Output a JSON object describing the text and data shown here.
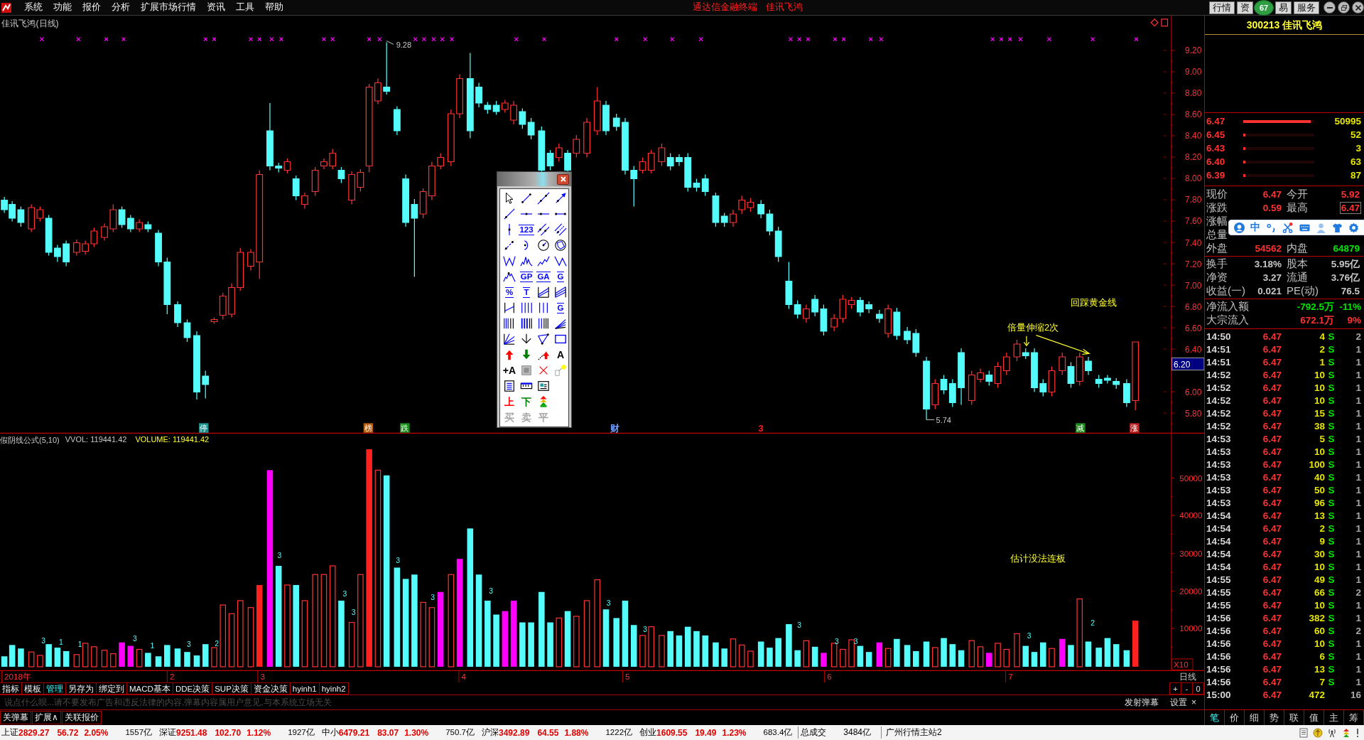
{
  "menu_bar": {
    "items": [
      "系统",
      "功能",
      "报价",
      "分析",
      "扩展市场行情",
      "资讯",
      "工具",
      "帮助"
    ],
    "title": "通达信金融终端",
    "subtitle": "佳讯飞鸿",
    "buttons": [
      "行情",
      "资",
      "易",
      "服务"
    ],
    "badge": "67"
  },
  "price_chart": {
    "title": "佳讯飞鸿(日线)",
    "high_label": "9.28",
    "low_label": "5.74",
    "annotations": [
      "回踩黄金线",
      "倍量伸缩2次"
    ],
    "event_tags": [
      {
        "kind": "tag",
        "text": "停",
        "color": "#1f8f8f"
      },
      {
        "kind": "tag",
        "text": "榜",
        "color": "#b05a10"
      },
      {
        "kind": "tag",
        "text": "跌",
        "color": "#1a8a1a"
      },
      {
        "kind": "text",
        "text": "财",
        "color": "#6f9fff"
      },
      {
        "kind": "text",
        "text": "3",
        "color": "#ff2020"
      },
      {
        "kind": "tag",
        "text": "减",
        "color": "#1a8a1a"
      },
      {
        "kind": "tag",
        "text": "涨",
        "color": "#c02020"
      }
    ],
    "axis_labels": [
      "9.20",
      "9.00",
      "8.80",
      "8.60",
      "8.40",
      "8.20",
      "8.00",
      "7.80",
      "7.60",
      "7.40",
      "7.20",
      "7.00",
      "6.80",
      "6.60",
      "6.40",
      "6.00",
      "5.80"
    ],
    "cursor_price": "6.20"
  },
  "volume_chart": {
    "indicator": "假阴线公式(5,10)",
    "vvol": "VVOL: 119441.42",
    "volume": "VOLUME: 119441.42",
    "annotation": "估计没法连板",
    "bar_marks": [
      "3",
      "1",
      "1",
      "3",
      "1",
      "3",
      "2",
      "3",
      "3",
      "3",
      "3",
      "3",
      "3",
      "3",
      "3",
      "3",
      "3",
      "3",
      "3",
      "2"
    ],
    "axis_labels": [
      "50000",
      "40000",
      "30000",
      "20000",
      "10000"
    ],
    "scale": "X10"
  },
  "date_axis": [
    "2018年",
    "2",
    "3",
    "4",
    "5",
    "6",
    "7"
  ],
  "period": "日线",
  "zoom_buttons": [
    "+",
    "-",
    "0"
  ],
  "formula_tabs": [
    {
      "label": "指标",
      "selected": false
    },
    {
      "label": "模板",
      "selected": false
    },
    {
      "label": "管理",
      "selected": true
    },
    {
      "label": "另存为",
      "selected": false
    },
    {
      "label": "绑定到",
      "selected": false
    },
    {
      "label": "MACD基本",
      "selected": false
    },
    {
      "label": "DDE决策",
      "selected": false
    },
    {
      "label": "SUP决策",
      "selected": false
    },
    {
      "label": "资金决策",
      "selected": false
    },
    {
      "label": "hyinh1",
      "selected": false
    },
    {
      "label": "hyinh2",
      "selected": false
    }
  ],
  "danmaku": {
    "placeholder": "说点什么呗...请不要发布广告和违反法律的内容,弹幕内容属用户意见,与本系统立场无关",
    "send": "发射弹幕",
    "settings": "设置",
    "close": "×"
  },
  "bottom_buttons": [
    "关弹幕",
    "扩展∧",
    "关联报价"
  ],
  "drawing_toolbar": {
    "rows": [
      {
        "tools": [
          {
            "kind": "pointer",
            "disabled": false
          },
          {
            "kind": "segment",
            "disabled": false
          },
          {
            "kind": "line",
            "disabled": false
          },
          {
            "kind": "arrowline",
            "disabled": false
          }
        ]
      },
      {
        "tools": [
          {
            "kind": "ray",
            "disabled": false
          },
          {
            "kind": "hray",
            "disabled": false
          },
          {
            "kind": "hline",
            "disabled": false
          },
          {
            "kind": "hsegment",
            "disabled": false
          }
        ]
      },
      {
        "tools": [
          {
            "kind": "vline",
            "disabled": false
          },
          {
            "kind": "ruled",
            "text": "123",
            "color": "#0000ff",
            "disabled": false
          },
          {
            "kind": "parallel",
            "disabled": false
          },
          {
            "kind": "channel",
            "disabled": false
          }
        ]
      },
      {
        "tools": [
          {
            "kind": "dashed",
            "disabled": false
          },
          {
            "kind": "arc",
            "disabled": false
          },
          {
            "kind": "circle",
            "disabled": false
          },
          {
            "kind": "cycle",
            "disabled": false
          }
        ]
      },
      {
        "tools": [
          {
            "kind": "wave",
            "disabled": false
          },
          {
            "kind": "peaks",
            "disabled": false
          },
          {
            "kind": "zigzag",
            "disabled": false
          },
          {
            "kind": "vshape",
            "disabled": false
          }
        ]
      },
      {
        "tools": [
          {
            "kind": "mountain",
            "disabled": false
          },
          {
            "kind": "ruled",
            "text": "GP",
            "color": "#0000ff",
            "disabled": false
          },
          {
            "kind": "ruled",
            "text": "GA",
            "color": "#0000ff",
            "disabled": false
          },
          {
            "kind": "ruled",
            "text": "G",
            "color": "#0000ff",
            "disabled": false
          }
        ]
      },
      {
        "tools": [
          {
            "kind": "ruled",
            "text": "%",
            "color": "#0000ff",
            "disabled": false
          },
          {
            "kind": "ruled",
            "text": "T",
            "color": "#0000ff",
            "disabled": false
          },
          {
            "kind": "fanbox",
            "disabled": false
          },
          {
            "kind": "fanbox2",
            "disabled": false
          }
        ]
      },
      {
        "tools": [
          {
            "kind": "timebar",
            "disabled": false
          },
          {
            "kind": "vlines4",
            "disabled": false
          },
          {
            "kind": "vlines3",
            "disabled": false
          },
          {
            "kind": "ruled",
            "text": "G",
            "color": "#0000ff",
            "disabled": false
          }
        ]
      },
      {
        "tools": [
          {
            "kind": "vlines6",
            "disabled": false
          },
          {
            "kind": "vlinesbold",
            "disabled": false
          },
          {
            "kind": "vlines5",
            "disabled": false
          },
          {
            "kind": "fan",
            "disabled": false
          }
        ]
      },
      {
        "tools": [
          {
            "kind": "gannfan",
            "disabled": false
          },
          {
            "kind": "vdown",
            "disabled": false
          },
          {
            "kind": "triangle",
            "disabled": false
          },
          {
            "kind": "rect",
            "disabled": false
          }
        ]
      },
      {
        "tools": [
          {
            "kind": "uparrow",
            "disabled": false
          },
          {
            "kind": "downarrow",
            "disabled": false
          },
          {
            "kind": "linearrow",
            "disabled": false
          },
          {
            "kind": "text",
            "text": "A",
            "color": "#000000",
            "disabled": false
          }
        ]
      },
      {
        "tools": [
          {
            "kind": "text",
            "text": "+A",
            "color": "#000000",
            "disabled": false
          },
          {
            "kind": "square",
            "disabled": false
          },
          {
            "kind": "cross",
            "disabled": false
          },
          {
            "kind": "pin",
            "disabled": false
          }
        ]
      },
      {
        "tools": [
          {
            "kind": "list",
            "disabled": false
          },
          {
            "kind": "ruler",
            "disabled": false
          },
          {
            "kind": "image",
            "disabled": false
          }
        ]
      },
      {
        "tools": [
          {
            "kind": "text",
            "text": "上",
            "color": "#ff0000",
            "disabled": false
          },
          {
            "kind": "text",
            "text": "下",
            "color": "#008000",
            "disabled": false
          },
          {
            "kind": "stack",
            "disabled": false
          }
        ]
      },
      {
        "tools": [
          {
            "kind": "text",
            "text": "买",
            "disabled": true
          },
          {
            "kind": "text",
            "text": "卖",
            "disabled": true
          },
          {
            "kind": "text",
            "text": "平",
            "disabled": true
          }
        ]
      }
    ]
  },
  "quote_panel": {
    "title": "300213 佳讯飞鸿",
    "bids": [
      {
        "price": "6.47",
        "volume": "50995",
        "level": 0.95
      },
      {
        "price": "6.45",
        "volume": "52",
        "level": 0.03
      },
      {
        "price": "6.43",
        "volume": "3",
        "level": 0.03
      },
      {
        "price": "6.40",
        "volume": "63",
        "level": 0.03
      },
      {
        "price": "6.39",
        "volume": "87",
        "level": 0.03
      }
    ],
    "stats": [
      {
        "cells": [
          {
            "label": "现价",
            "value": "6.47",
            "color": "#ff3232",
            "boxed": false
          },
          {
            "label": "今开",
            "value": "5.92",
            "color": "#ff3232",
            "boxed": false
          }
        ]
      },
      {
        "cells": [
          {
            "label": "涨跌",
            "value": "0.59",
            "color": "#ff3232",
            "boxed": false
          },
          {
            "label": "最高",
            "value": "6.47",
            "color": "#ff3232",
            "boxed": true
          }
        ]
      },
      {
        "cells": [
          {
            "label": "涨幅"
          }
        ]
      },
      {
        "cells": [
          {
            "label": "总量"
          }
        ]
      },
      {
        "cells": [
          {
            "label": "外盘",
            "value": "54562",
            "color": "#ff3232",
            "boxed": false
          },
          {
            "label": "内盘",
            "value": "64879",
            "color": "#00e600",
            "boxed": false
          }
        ]
      }
    ],
    "fundamentals": [
      {
        "cells": [
          {
            "label": "换手",
            "value": "3.18%",
            "color": "#c8c8c8",
            "boxed": false
          },
          {
            "label": "股本",
            "value": "5.95亿",
            "color": "#c8c8c8",
            "boxed": false
          }
        ]
      },
      {
        "cells": [
          {
            "label": "净资",
            "value": "3.27",
            "color": "#c8c8c8",
            "boxed": false
          },
          {
            "label": "流通",
            "value": "3.76亿",
            "color": "#c8c8c8",
            "boxed": false
          }
        ]
      },
      {
        "cells": [
          {
            "label": "收益(一)",
            "value": "0.021",
            "color": "#c8c8c8",
            "boxed": false
          },
          {
            "label": "PE(动)",
            "value": "76.5",
            "color": "#c8c8c8",
            "boxed": false
          }
        ]
      }
    ],
    "flows": [
      {
        "label": "净流入额",
        "amount": "-792.5万",
        "percent": "-11%",
        "color": "#00e600"
      },
      {
        "label": "大宗流入",
        "amount": "672.1万",
        "percent": "9%",
        "color": "#ff3232"
      }
    ],
    "ticks": [
      {
        "time": "14:50",
        "price": "6.47",
        "volume": "4",
        "side": "S",
        "count": "2"
      },
      {
        "time": "14:51",
        "price": "6.47",
        "volume": "2",
        "side": "S",
        "count": "1"
      },
      {
        "time": "14:51",
        "price": "6.47",
        "volume": "1",
        "side": "S",
        "count": "1"
      },
      {
        "time": "14:52",
        "price": "6.47",
        "volume": "10",
        "side": "S",
        "count": "1"
      },
      {
        "time": "14:52",
        "price": "6.47",
        "volume": "10",
        "side": "S",
        "count": "1"
      },
      {
        "time": "14:52",
        "price": "6.47",
        "volume": "10",
        "side": "S",
        "count": "1"
      },
      {
        "time": "14:52",
        "price": "6.47",
        "volume": "15",
        "side": "S",
        "count": "1"
      },
      {
        "time": "14:52",
        "price": "6.47",
        "volume": "38",
        "side": "S",
        "count": "1"
      },
      {
        "time": "14:53",
        "price": "6.47",
        "volume": "5",
        "side": "S",
        "count": "1"
      },
      {
        "time": "14:53",
        "price": "6.47",
        "volume": "10",
        "side": "S",
        "count": "1"
      },
      {
        "time": "14:53",
        "price": "6.47",
        "volume": "100",
        "side": "S",
        "count": "1"
      },
      {
        "time": "14:53",
        "price": "6.47",
        "volume": "40",
        "side": "S",
        "count": "1"
      },
      {
        "time": "14:53",
        "price": "6.47",
        "volume": "50",
        "side": "S",
        "count": "1"
      },
      {
        "time": "14:53",
        "price": "6.47",
        "volume": "96",
        "side": "S",
        "count": "1"
      },
      {
        "time": "14:54",
        "price": "6.47",
        "volume": "13",
        "side": "S",
        "count": "1"
      },
      {
        "time": "14:54",
        "price": "6.47",
        "volume": "2",
        "side": "S",
        "count": "1"
      },
      {
        "time": "14:54",
        "price": "6.47",
        "volume": "9",
        "side": "S",
        "count": "1"
      },
      {
        "time": "14:54",
        "price": "6.47",
        "volume": "30",
        "side": "S",
        "count": "1"
      },
      {
        "time": "14:54",
        "price": "6.47",
        "volume": "10",
        "side": "S",
        "count": "1"
      },
      {
        "time": "14:55",
        "price": "6.47",
        "volume": "49",
        "side": "S",
        "count": "1"
      },
      {
        "time": "14:55",
        "price": "6.47",
        "volume": "66",
        "side": "S",
        "count": "2"
      },
      {
        "time": "14:55",
        "price": "6.47",
        "volume": "10",
        "side": "S",
        "count": "1"
      },
      {
        "time": "14:56",
        "price": "6.47",
        "volume": "382",
        "side": "S",
        "count": "1"
      },
      {
        "time": "14:56",
        "price": "6.47",
        "volume": "60",
        "side": "S",
        "count": "2"
      },
      {
        "time": "14:56",
        "price": "6.47",
        "volume": "10",
        "side": "S",
        "count": "1"
      },
      {
        "time": "14:56",
        "price": "6.47",
        "volume": "6",
        "side": "S",
        "count": "1"
      },
      {
        "time": "14:56",
        "price": "6.47",
        "volume": "13",
        "side": "S",
        "count": "1"
      },
      {
        "time": "14:56",
        "price": "6.47",
        "volume": "7",
        "side": "S",
        "count": "1"
      },
      {
        "time": "15:00",
        "price": "6.47",
        "volume": "472",
        "count": "16"
      }
    ],
    "tabs": [
      {
        "label": "笔",
        "selected": true
      },
      {
        "label": "价",
        "selected": false
      },
      {
        "label": "细",
        "selected": false
      },
      {
        "label": "势",
        "selected": false
      },
      {
        "label": "联",
        "selected": false
      },
      {
        "label": "值",
        "selected": false
      },
      {
        "label": "主",
        "selected": false
      },
      {
        "label": "筹",
        "selected": false
      }
    ]
  },
  "ime_toolbar": {
    "mode": "中"
  },
  "market_indices": [
    {
      "name": "上证",
      "value": "2829.27",
      "change": "56.72",
      "percent": "2.05%",
      "amount": "1557亿"
    },
    {
      "name": "深证",
      "value": "9251.48",
      "change": "102.70",
      "percent": "1.12%",
      "amount": "1927亿"
    },
    {
      "name": "中小",
      "value": "6479.21",
      "change": "83.07",
      "percent": "1.30%",
      "amount": "750.7亿"
    },
    {
      "name": "沪深",
      "value": "3492.89",
      "change": "64.55",
      "percent": "1.88%",
      "amount": "1222亿"
    },
    {
      "name": "创业",
      "value": "1609.55",
      "change": "19.49",
      "percent": "1.23%",
      "amount": "683.4亿"
    }
  ],
  "total_turnover": {
    "label": "总成交",
    "value": "3484亿"
  },
  "server": "广州行情主站2"
}
